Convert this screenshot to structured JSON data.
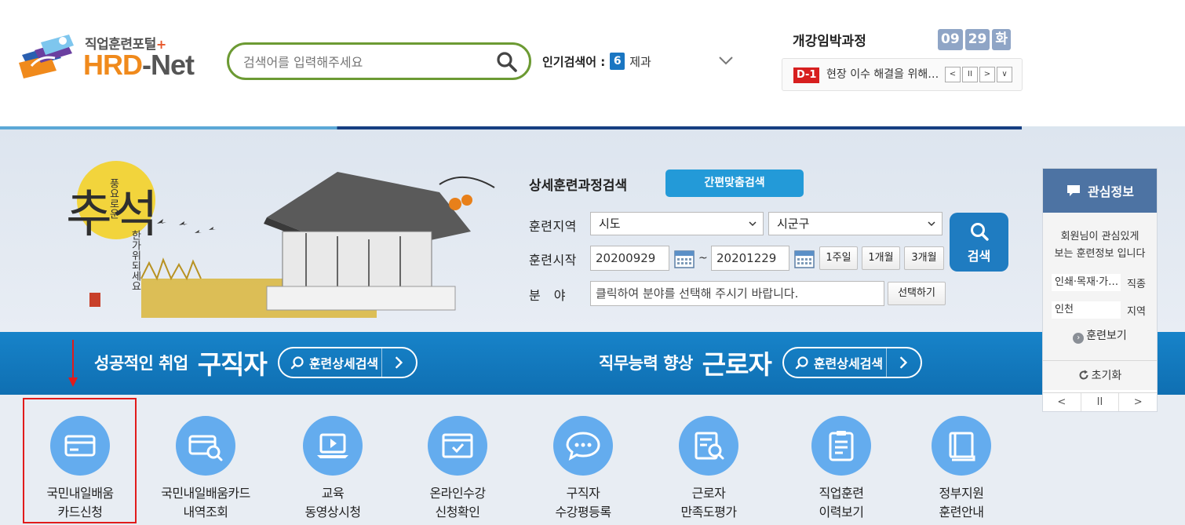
{
  "header": {
    "logo_sub": "직업훈련포털",
    "logo_plus": "+",
    "logo_main_1": "HRD",
    "logo_main_2": "-Net",
    "search_placeholder": "검색어를 입력해주세요",
    "popular_label": "인기검색어 :",
    "popular_rank": "6",
    "popular_keyword": "제과",
    "open_soon_title": "개강임박과정",
    "date_month": "09",
    "date_day": "29",
    "date_weekday": "화",
    "ticker_badge": "D-1",
    "ticker_text": "현장 이수 해결을 위해 진행하는",
    "ticker_controls": [
      "<",
      "II",
      ">",
      "∨"
    ]
  },
  "search": {
    "title": "상세훈련과정검색",
    "quick_button": "간편맞춤검색",
    "region_label": "훈련지역",
    "region_sido": "시도",
    "region_sigungu": "시군구",
    "start_label": "훈련시작",
    "date_from": "20200929",
    "date_sep": "~",
    "date_to": "20201229",
    "period_1w": "1주일",
    "period_1m": "1개월",
    "period_3m": "3개월",
    "field_label": "분　야",
    "field_placeholder": "클릭하여 분야를 선택해 주시기 바랍니다.",
    "field_select_button": "선택하기",
    "search_button": "검색"
  },
  "banner": {
    "art_title": "추석",
    "art_line_1": "풍요로운",
    "art_line_2": "한가위되세요"
  },
  "bluebar": {
    "left_small": "성공적인 취업",
    "left_big": "구직자",
    "left_pill": "훈련상세검색",
    "right_small": "직무능력 향상",
    "right_big": "근로자",
    "right_pill": "훈련상세검색"
  },
  "menu": [
    {
      "l1": "국민내일배움",
      "l2": "카드신청",
      "icon": "credit-card-icon"
    },
    {
      "l1": "국민내일배움카드",
      "l2": "내역조회",
      "icon": "card-search-icon"
    },
    {
      "l1": "교육",
      "l2": "동영상시청",
      "icon": "video-laptop-icon"
    },
    {
      "l1": "온라인수강",
      "l2": "신청확인",
      "icon": "browser-check-icon"
    },
    {
      "l1": "구직자",
      "l2": "수강평등록",
      "icon": "chat-bubble-icon"
    },
    {
      "l1": "근로자",
      "l2": "만족도평가",
      "icon": "doc-search-icon"
    },
    {
      "l1": "직업훈련",
      "l2": "이력보기",
      "icon": "clipboard-icon"
    },
    {
      "l1": "정부지원",
      "l2": "훈련안내",
      "icon": "book-icon"
    }
  ],
  "interest": {
    "title": "관심정보",
    "desc_1": "회원님이 관심있게",
    "desc_2": "보는 훈련정보 입니다",
    "job_value": "인쇄·목재·가구·공예",
    "job_key": "직종",
    "region_value": "인천",
    "region_key": "지역",
    "more": "훈련보기",
    "reset": "초기화",
    "pager": [
      "<",
      "II",
      ">"
    ]
  },
  "colors": {
    "brand_blue": "#1f7cc1",
    "search_green": "#6c9a33",
    "menu_icon": "#64acee",
    "highlight_red": "#e11b1b"
  }
}
